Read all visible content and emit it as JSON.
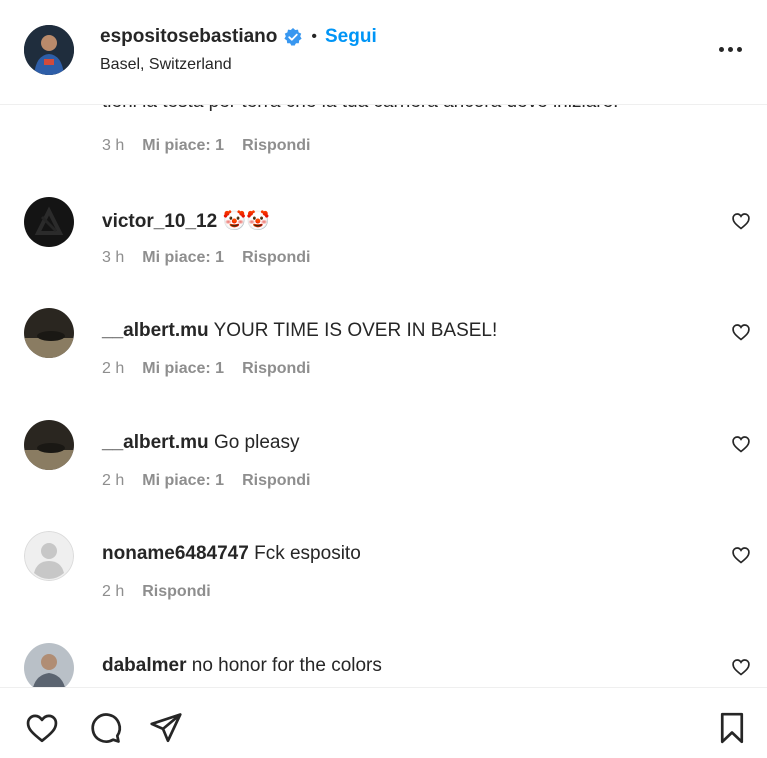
{
  "header": {
    "username": "espositosebastiano",
    "separator": "•",
    "follow_label": "Segui",
    "location": "Basel, Switzerland",
    "avatar_icon": "profile-photo",
    "verified_icon": "verified-badge-icon",
    "more_icon": "more-options-icon",
    "accent": "#0095f6"
  },
  "comments": {
    "cut_comment": {
      "text": "tieni la testa per terra che la tua carriera ancora deve iniziare!",
      "time": "3 h",
      "likes": "Mi piace: 1",
      "reply": "Rispondi"
    },
    "items": [
      {
        "user": "victor_10_12",
        "text": "🤡🤡",
        "time": "3 h",
        "likes": "Mi piace: 1",
        "reply": "Rispondi"
      },
      {
        "user": "__albert.mu",
        "text": "YOUR TIME IS OVER IN BASEL!",
        "time": "2 h",
        "likes": "Mi piace: 1",
        "reply": "Rispondi"
      },
      {
        "user": "__albert.mu",
        "text": "Go pleasy",
        "time": "2 h",
        "likes": "Mi piace: 1",
        "reply": "Rispondi"
      },
      {
        "user": "noname6484747",
        "text": "Fck esposito",
        "time": "2 h",
        "reply": "Rispondi"
      },
      {
        "user": "dabalmer",
        "text": "no honor for the colors"
      }
    ]
  },
  "footer": {
    "like_icon": "heart-icon",
    "comment_icon": "comment-icon",
    "share_icon": "send-icon",
    "save_icon": "bookmark-icon"
  }
}
